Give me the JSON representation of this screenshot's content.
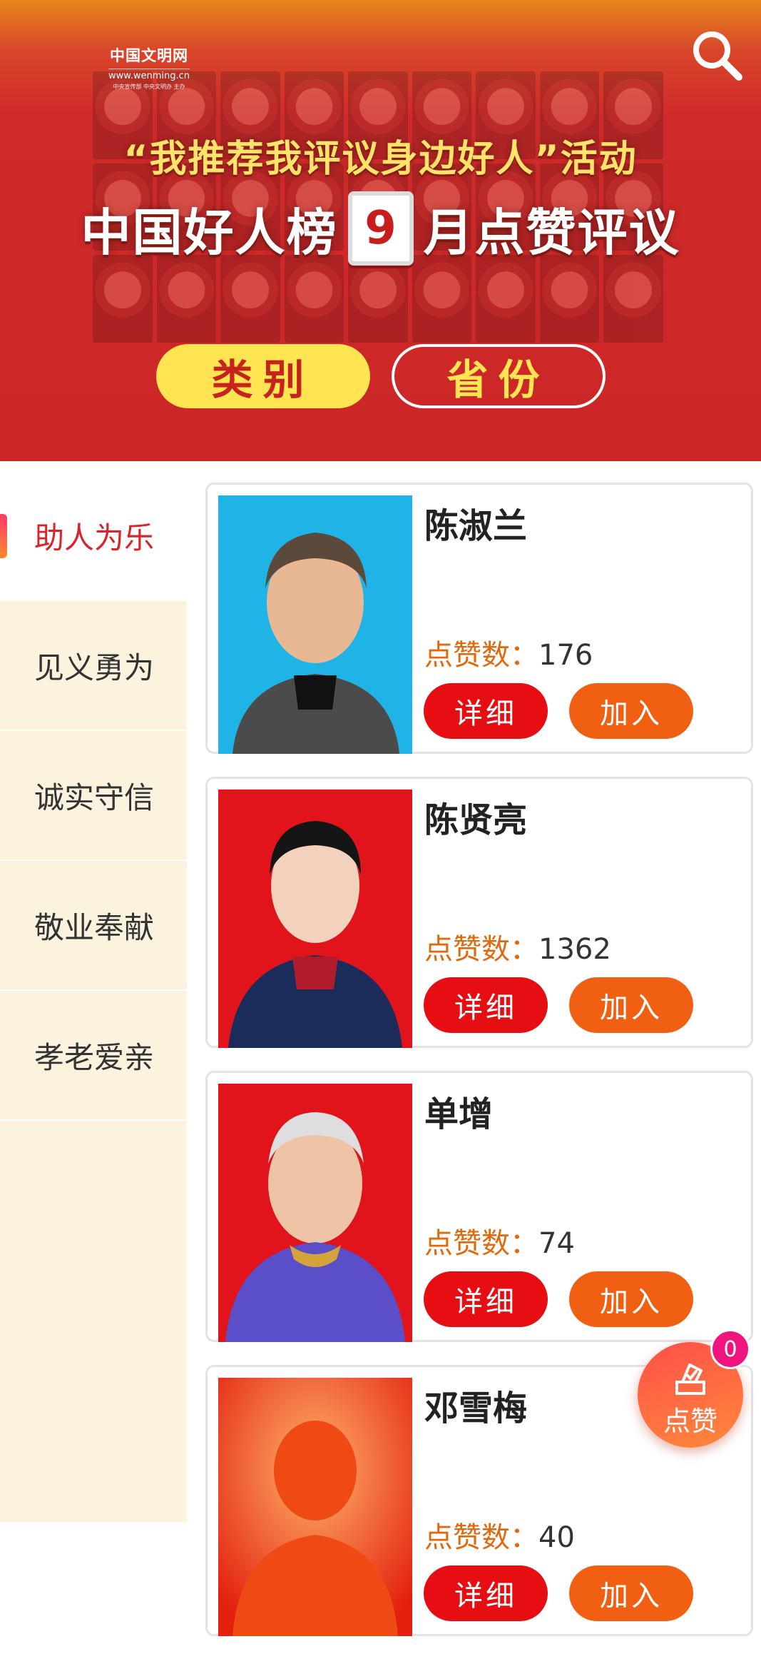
{
  "banner": {
    "logo_name": "中国文明网",
    "logo_url": "www.wenming.cn",
    "logo_sub": "中央宣传部 中央文明办 主办",
    "headline": "“我推荐我评议身边好人”活动",
    "title_left": "中国好人榜",
    "month": "9",
    "title_right": "月点赞评议",
    "filter_category": "类别",
    "filter_province": "省份",
    "search_icon": "search-icon"
  },
  "sidebar": {
    "items": [
      {
        "label": "助人为乐",
        "active": true
      },
      {
        "label": "见义勇为",
        "active": false
      },
      {
        "label": "诚实守信",
        "active": false
      },
      {
        "label": "敬业奉献",
        "active": false
      },
      {
        "label": "孝老爱亲",
        "active": false
      }
    ]
  },
  "cards": [
    {
      "name": "陈淑兰",
      "likes_label": "点赞数：",
      "likes": "176",
      "detail_label": "详细",
      "join_label": "加入",
      "photo_bg": "#1fb3e6"
    },
    {
      "name": "陈贤亮",
      "likes_label": "点赞数：",
      "likes": "1362",
      "detail_label": "详细",
      "join_label": "加入",
      "photo_bg": "#e0141a"
    },
    {
      "name": "单增",
      "likes_label": "点赞数：",
      "likes": "74",
      "detail_label": "详细",
      "join_label": "加入",
      "photo_bg": "#e0141a"
    },
    {
      "name": "邓雪梅",
      "likes_label": "点赞数：",
      "likes": "40",
      "detail_label": "详细",
      "join_label": "加入",
      "photo_bg": "#ee2a10"
    }
  ],
  "vote": {
    "label": "点赞",
    "count": "0",
    "icon": "ballot-box-icon"
  },
  "colors": {
    "accent_red": "#e60e13",
    "accent_orange": "#f16012",
    "sidebar_bg": "#fcf3df",
    "likes_label": "#e2690b"
  }
}
